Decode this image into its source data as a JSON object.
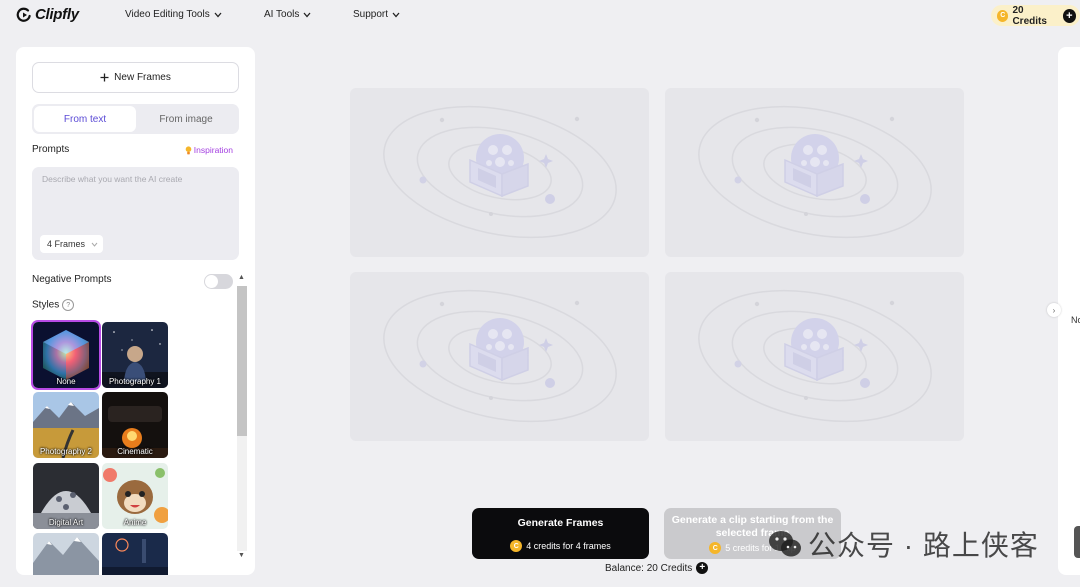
{
  "app": {
    "logo_text": "Clipfly"
  },
  "nav": {
    "items": [
      {
        "label": "Video Editing Tools"
      },
      {
        "label": "AI Tools"
      },
      {
        "label": "Support"
      }
    ],
    "credits_label": "20 Credits",
    "coin_symbol": "C"
  },
  "left_panel": {
    "new_frames_label": "New Frames",
    "tabs": [
      {
        "label": "From text",
        "active": true
      },
      {
        "label": "From image",
        "active": false
      }
    ],
    "prompts_label": "Prompts",
    "inspiration_label": "Inspiration",
    "prompt_placeholder": "Describe what you want the AI create",
    "frames_option": "4 Frames",
    "negative_prompts_label": "Negative Prompts",
    "negative_prompts_enabled": false,
    "styles_label": "Styles",
    "help_icon_symbol": "?",
    "styles": [
      {
        "label": "None",
        "selected": true
      },
      {
        "label": "Photography 1",
        "selected": false
      },
      {
        "label": "Photography 2",
        "selected": false
      },
      {
        "label": "Cinematic",
        "selected": false
      },
      {
        "label": "Digital Art",
        "selected": false
      },
      {
        "label": "Anime",
        "selected": false
      },
      {
        "label": "",
        "selected": false
      },
      {
        "label": "",
        "selected": false
      }
    ]
  },
  "canvas": {
    "frame_count": 4
  },
  "actions": {
    "generate_frames_title": "Generate Frames",
    "generate_frames_cost": "4 credits for 4 frames",
    "clip_title": "Generate a clip starting from the selected frame",
    "clip_cost": "5 credits for 1 clip",
    "balance_label": "Balance: 20 Credits"
  },
  "right_panel": {
    "label": "No"
  },
  "watermark": {
    "text": "公众号 · 路上侠客"
  },
  "colors": {
    "accent": "#5b4bd6",
    "inspiration": "#a33ee0",
    "primary_button": "#0b0b0d",
    "disabled_button": "#cacacd",
    "coin": "#f5b62a",
    "credits_pill": "#fbf0c9"
  }
}
